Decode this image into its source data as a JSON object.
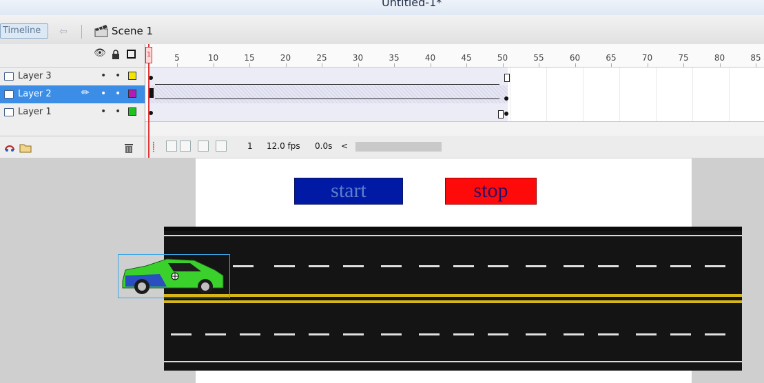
{
  "window": {
    "title": "Untitled-1*"
  },
  "header": {
    "timeline_tab": "Timeline",
    "scene_label": "Scene 1"
  },
  "layers": [
    {
      "name": "Layer 3",
      "color": "#f4e400",
      "selected": false
    },
    {
      "name": "Layer 2",
      "color": "#b21bb8",
      "selected": true
    },
    {
      "name": "Layer 1",
      "color": "#1fc31f",
      "selected": false
    }
  ],
  "ruler": {
    "first_frame": "1",
    "numbers": [
      "5",
      "10",
      "15",
      "20",
      "25",
      "30",
      "35",
      "40",
      "45",
      "50",
      "55",
      "60",
      "65",
      "70",
      "75",
      "80",
      "85"
    ]
  },
  "footer": {
    "current_frame": "1",
    "fps": "12.0 fps",
    "time": "0.0s",
    "scroll_left": "<"
  },
  "stage": {
    "start_label": "start",
    "stop_label": "stop",
    "start_color": "#001aa6",
    "stop_color": "#ff0a0a"
  },
  "icons": {
    "eye": "eye-icon",
    "lock": "lock-icon",
    "outline": "outline-square-icon",
    "trash": "trash-icon",
    "pencil": "pencil-icon",
    "scene": "clapper-icon",
    "back": "back-arrow-icon",
    "new_layer": "new-layer-icon",
    "folder": "folder-icon"
  }
}
